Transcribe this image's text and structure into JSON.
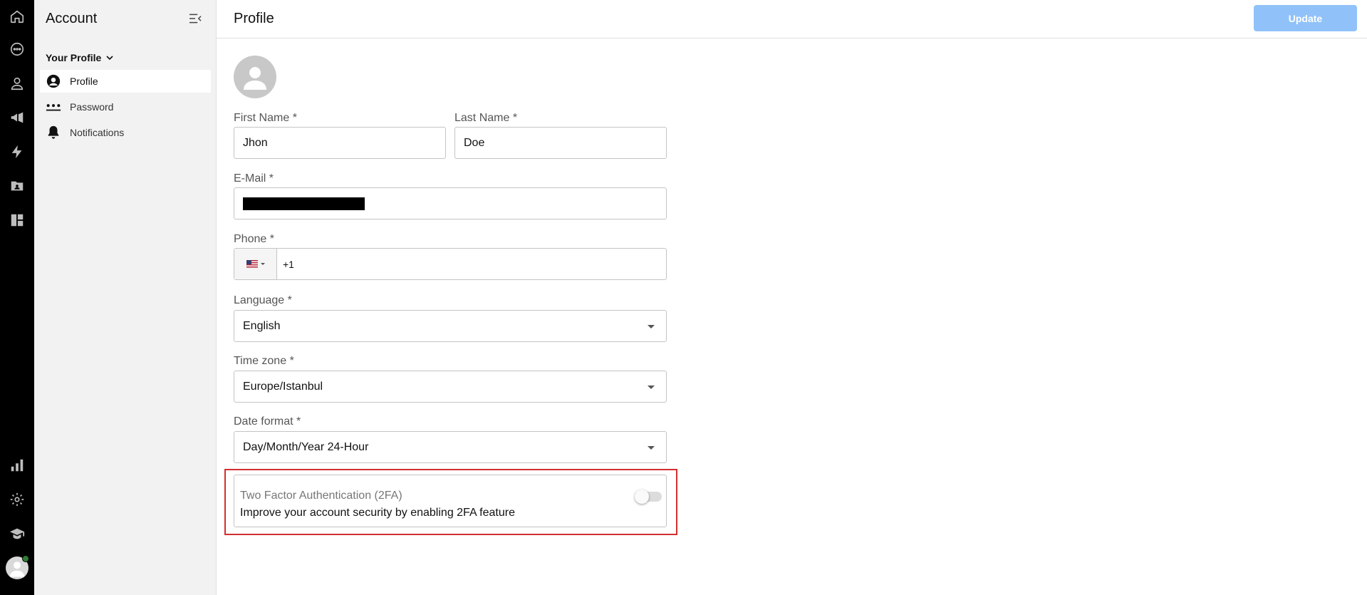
{
  "rail": {
    "icons": [
      "home-icon",
      "chat-icon",
      "contacts-icon",
      "megaphone-icon",
      "lightning-icon",
      "folder-icon",
      "dashboard-icon",
      "bar-chart-icon",
      "gear-icon",
      "graduation-cap-icon"
    ],
    "status_color": "#2e7d32"
  },
  "sidebar": {
    "title": "Account",
    "group": "Your Profile",
    "items": [
      {
        "label": "Profile",
        "icon": "user-circle-icon",
        "active": true
      },
      {
        "label": "Password",
        "icon": "password-dots-icon",
        "active": false
      },
      {
        "label": "Notifications",
        "icon": "bell-icon",
        "active": false
      }
    ]
  },
  "header": {
    "title": "Profile",
    "update_label": "Update",
    "update_color": "#90c2f9"
  },
  "form": {
    "first_name": {
      "label": "First Name",
      "required": "*",
      "value": "Jhon"
    },
    "last_name": {
      "label": "Last Name",
      "required": "*",
      "value": "Doe"
    },
    "email": {
      "label": "E-Mail",
      "required": "*"
    },
    "phone": {
      "label": "Phone",
      "required": "*",
      "value": "+1",
      "country": "us-flag-icon"
    },
    "language": {
      "label": "Language",
      "required": "*",
      "value": "English"
    },
    "timezone": {
      "label": "Time zone",
      "required": "*",
      "value": "Europe/Istanbul"
    },
    "date_format": {
      "label": "Date format",
      "required": "*",
      "value": "Day/Month/Year 24-Hour"
    }
  },
  "tfa": {
    "title": "Two Factor Authentication (2FA)",
    "description": "Improve your account security by enabling 2FA feature",
    "enabled": false,
    "highlight_color": "#d32f2f"
  }
}
